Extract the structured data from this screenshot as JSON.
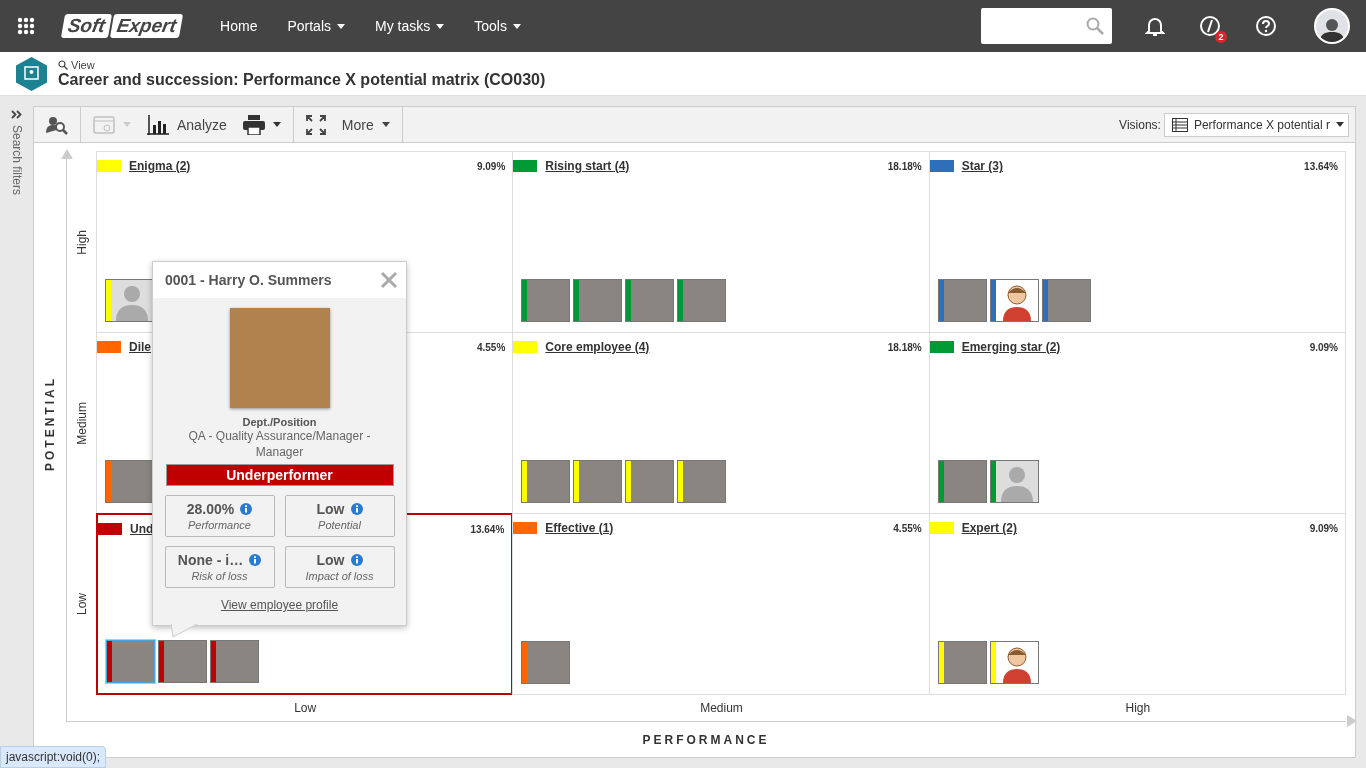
{
  "topbar": {
    "logo": [
      "Soft",
      "Expert"
    ],
    "nav": [
      {
        "label": "Home",
        "dropdown": false
      },
      {
        "label": "Portals",
        "dropdown": true
      },
      {
        "label": "My tasks",
        "dropdown": true
      },
      {
        "label": "Tools",
        "dropdown": true
      }
    ],
    "notification_badge": "2"
  },
  "header": {
    "breadcrumb": "View",
    "title": "Career and succession: Performance X potential matrix (CO030)"
  },
  "sidebar": {
    "label": "Search filters"
  },
  "toolbar": {
    "view_button": {
      "disabled": true
    },
    "analyze": "Analyze",
    "more": "More",
    "visions_label": "Visions:",
    "visions_value": "Performance X potential r"
  },
  "matrix": {
    "y_title": "POTENTIAL",
    "x_title": "PERFORMANCE",
    "rows": [
      "High",
      "Medium",
      "Low"
    ],
    "columns": [
      "Low",
      "Medium",
      "High"
    ],
    "cells": [
      {
        "title": "Enigma (2)",
        "percent": "9.09%",
        "color": "#ffff00",
        "selected": false,
        "employees": [
          {
            "kind": "silhouette",
            "color": "#ffff00",
            "selected": false
          }
        ]
      },
      {
        "title": "Rising start (4)",
        "percent": "18.18%",
        "color": "#009933",
        "selected": false,
        "employees": [
          {
            "kind": "photo",
            "color": "#009933",
            "selected": false
          },
          {
            "kind": "photo",
            "color": "#009933",
            "selected": false
          },
          {
            "kind": "photo",
            "color": "#009933",
            "selected": false
          },
          {
            "kind": "photo",
            "color": "#009933",
            "selected": false
          }
        ]
      },
      {
        "title": "Star (3)",
        "percent": "13.64%",
        "color": "#2e6fba",
        "selected": false,
        "employees": [
          {
            "kind": "photo",
            "color": "#2e6fba",
            "selected": false
          },
          {
            "kind": "avatar",
            "color": "#2e6fba",
            "selected": false
          },
          {
            "kind": "photo",
            "color": "#2e6fba",
            "selected": false
          }
        ]
      },
      {
        "title": "Dile",
        "percent": "4.55%",
        "color": "#ff6600",
        "selected": false,
        "employees": [
          {
            "kind": "photo",
            "color": "#ff6600",
            "selected": false
          }
        ]
      },
      {
        "title": "Core employee (4)",
        "percent": "18.18%",
        "color": "#ffff00",
        "selected": false,
        "employees": [
          {
            "kind": "photo",
            "color": "#ffff00",
            "selected": false
          },
          {
            "kind": "photo",
            "color": "#ffff00",
            "selected": false
          },
          {
            "kind": "photo",
            "color": "#ffff00",
            "selected": false
          },
          {
            "kind": "photo",
            "color": "#ffff00",
            "selected": false
          }
        ]
      },
      {
        "title": "Emerging star (2)",
        "percent": "9.09%",
        "color": "#009933",
        "selected": false,
        "employees": [
          {
            "kind": "photo",
            "color": "#009933",
            "selected": false
          },
          {
            "kind": "silhouette",
            "color": "#009933",
            "selected": false
          }
        ]
      },
      {
        "title": "Und",
        "percent": "13.64%",
        "color": "#c00000",
        "selected": true,
        "employees": [
          {
            "kind": "photo",
            "color": "#c00000",
            "selected": true
          },
          {
            "kind": "photo",
            "color": "#c00000",
            "selected": false
          },
          {
            "kind": "photo",
            "color": "#c00000",
            "selected": false
          }
        ]
      },
      {
        "title": "Effective (1)",
        "percent": "4.55%",
        "color": "#ff6600",
        "selected": false,
        "employees": [
          {
            "kind": "photo",
            "color": "#ff6600",
            "selected": false
          }
        ]
      },
      {
        "title": "Expert (2)",
        "percent": "9.09%",
        "color": "#ffff00",
        "selected": false,
        "employees": [
          {
            "kind": "photo",
            "color": "#ffff00",
            "selected": false
          },
          {
            "kind": "avatar",
            "color": "#ffff00",
            "selected": false
          }
        ]
      }
    ]
  },
  "popup": {
    "title": "0001 - Harry O. Summers",
    "dept_label": "Dept./Position",
    "dept_value": "QA - Quality Assurance/Manager - Manager",
    "status": "Underperformer",
    "metrics": [
      {
        "value": "28.00%",
        "label": "Performance"
      },
      {
        "value": "Low",
        "label": "Potential"
      },
      {
        "value": "None - i…",
        "label": "Risk of loss"
      },
      {
        "value": "Low",
        "label": "Impact of loss"
      }
    ],
    "link": "View employee profile"
  },
  "status_tip": "javascript:void(0);"
}
